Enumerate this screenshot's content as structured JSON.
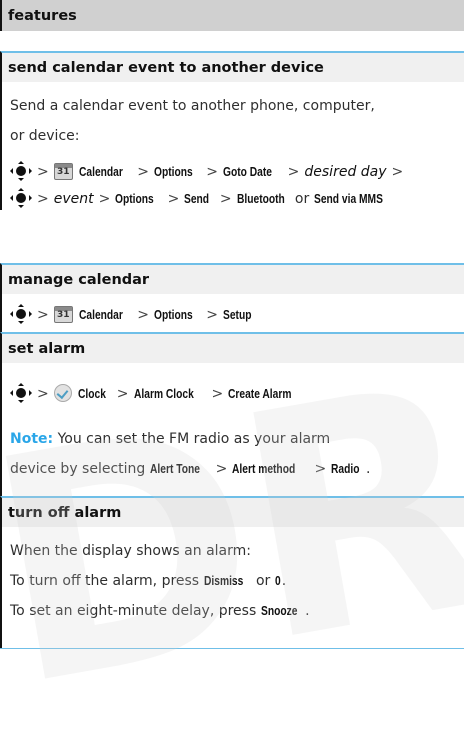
{
  "header": {
    "title": "features"
  },
  "sections": {
    "send": {
      "title": "send calendar event to another device",
      "intro_1": "Send a calendar event to another phone, computer,",
      "intro_2": "or device:",
      "path1": {
        "calendar": "Calendar",
        "options": "Options",
        "goto_date": "Goto Date",
        "desired_day": "desired day"
      },
      "path2": {
        "event": "event",
        "options": "Options",
        "send": "Send",
        "bluetooth": "Bluetooth",
        "or": "or",
        "send_via_mms": "Send via MMS"
      }
    },
    "manage": {
      "title": "manage calendar",
      "path": {
        "calendar": "Calendar",
        "options": "Options",
        "setup": "Setup"
      }
    },
    "alarm": {
      "title": "set alarm",
      "path": {
        "clock": "Clock",
        "alarm_clock": "Alarm Clock",
        "create_alarm": "Create Alarm"
      },
      "note_label": "Note:",
      "note_1": " You can set the FM radio as your alarm",
      "note_2_pre": "device by selecting ",
      "alert_tone": "Alert Tone",
      "alert_method": "Alert method",
      "radio": "Radio",
      "period": "."
    },
    "off": {
      "title": "turn off alarm",
      "line_1": "When the display shows an alarm:",
      "line_2_pre": "To turn off the alarm, press ",
      "dismiss": "Dismiss",
      "or": " or ",
      "zero": "0",
      "period": ".",
      "line_3_pre": "To set an eight-minute delay, press ",
      "snooze": "Snooze",
      "period2": "."
    }
  },
  "icons": {
    "nav": "nav-key-icon",
    "calendar": "calendar-icon",
    "clock": "clock-icon"
  },
  "calendar_icon_number": "31",
  "separator": ">",
  "watermark": "DRAFT",
  "colors": {
    "accent": "#2aa6e8",
    "rule": "#6fbfe8",
    "header_bg": "#d0d0d0"
  }
}
